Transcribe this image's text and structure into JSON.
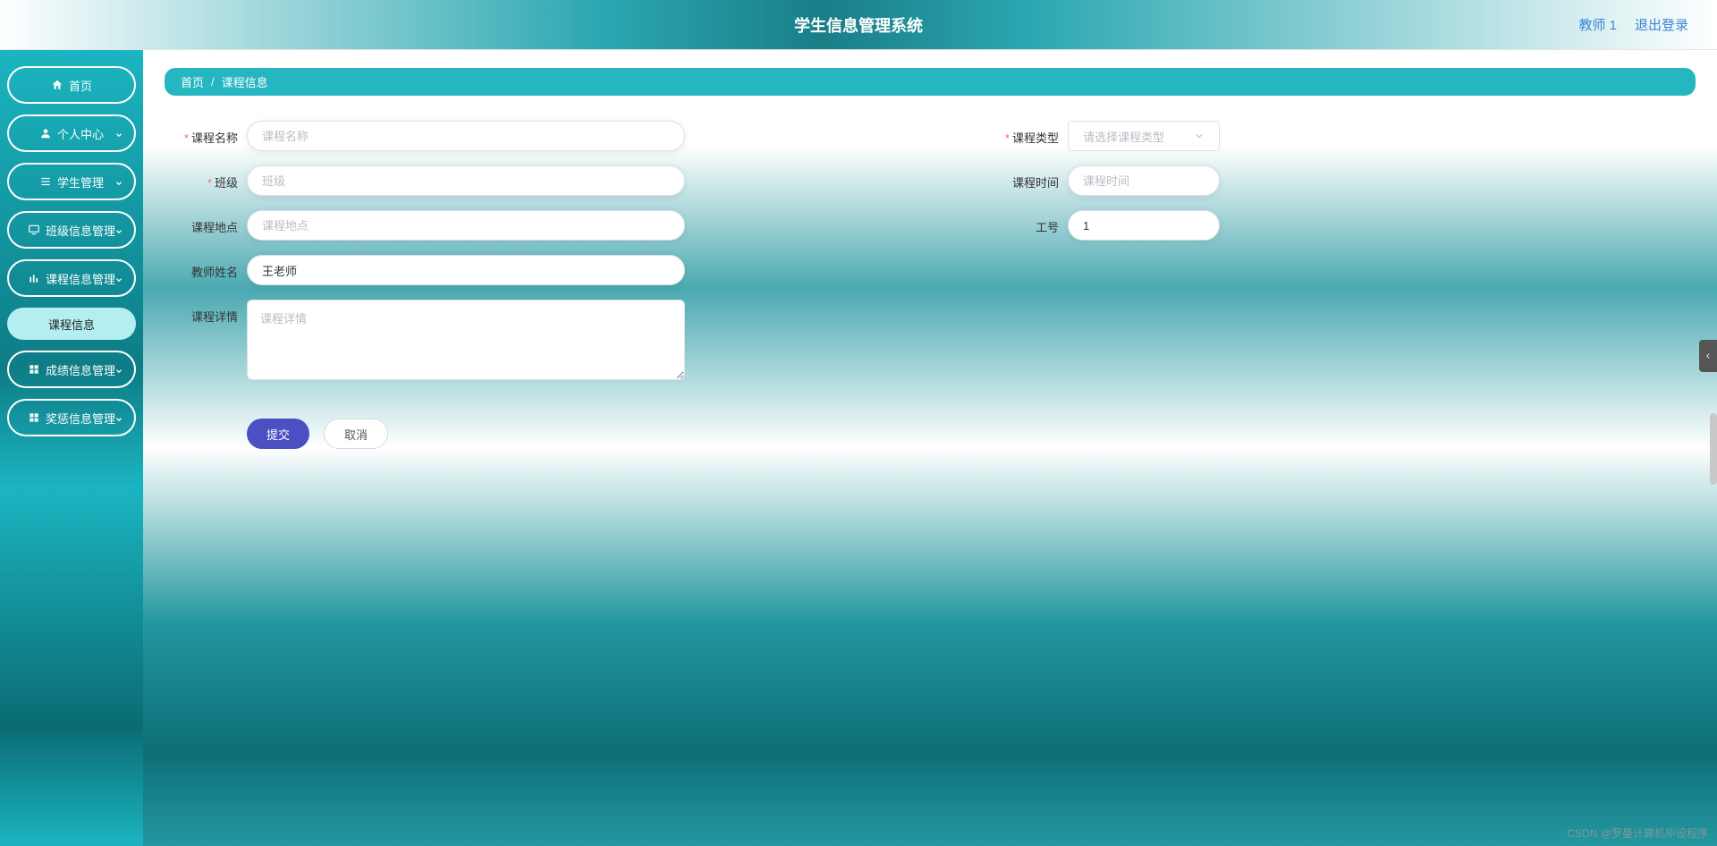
{
  "header": {
    "title": "学生信息管理系统",
    "user_label": "教师 1",
    "logout_label": "退出登录"
  },
  "sidebar": {
    "items": [
      {
        "label": "首页",
        "icon": "home-icon",
        "expandable": false
      },
      {
        "label": "个人中心",
        "icon": "user-icon",
        "expandable": true
      },
      {
        "label": "学生管理",
        "icon": "list-icon",
        "expandable": true
      },
      {
        "label": "班级信息管理",
        "icon": "screen-icon",
        "expandable": true
      },
      {
        "label": "课程信息管理",
        "icon": "bars-icon",
        "expandable": true,
        "active": true,
        "children": [
          {
            "label": "课程信息"
          }
        ]
      },
      {
        "label": "成绩信息管理",
        "icon": "grid-icon",
        "expandable": true
      },
      {
        "label": "奖惩信息管理",
        "icon": "grid-icon",
        "expandable": true
      }
    ]
  },
  "breadcrumb": {
    "root": "首页",
    "separator": "/",
    "current": "课程信息"
  },
  "form": {
    "course_name": {
      "label": "课程名称",
      "placeholder": "课程名称",
      "value": "",
      "required": true
    },
    "course_type": {
      "label": "课程类型",
      "placeholder": "请选择课程类型",
      "value": "",
      "required": true
    },
    "class": {
      "label": "班级",
      "placeholder": "班级",
      "value": "",
      "required": true
    },
    "course_time": {
      "label": "课程时间",
      "placeholder": "课程时间",
      "value": "",
      "required": false
    },
    "course_location": {
      "label": "课程地点",
      "placeholder": "课程地点",
      "value": "",
      "required": false
    },
    "job_number": {
      "label": "工号",
      "placeholder": "",
      "value": "1",
      "required": false
    },
    "teacher_name": {
      "label": "教师姓名",
      "placeholder": "",
      "value": "王老师",
      "required": false
    },
    "course_detail": {
      "label": "课程详情",
      "placeholder": "课程详情",
      "value": "",
      "required": false
    }
  },
  "buttons": {
    "submit": "提交",
    "cancel": "取消"
  },
  "watermark": "CSDN @罗曼计算机毕设程序"
}
